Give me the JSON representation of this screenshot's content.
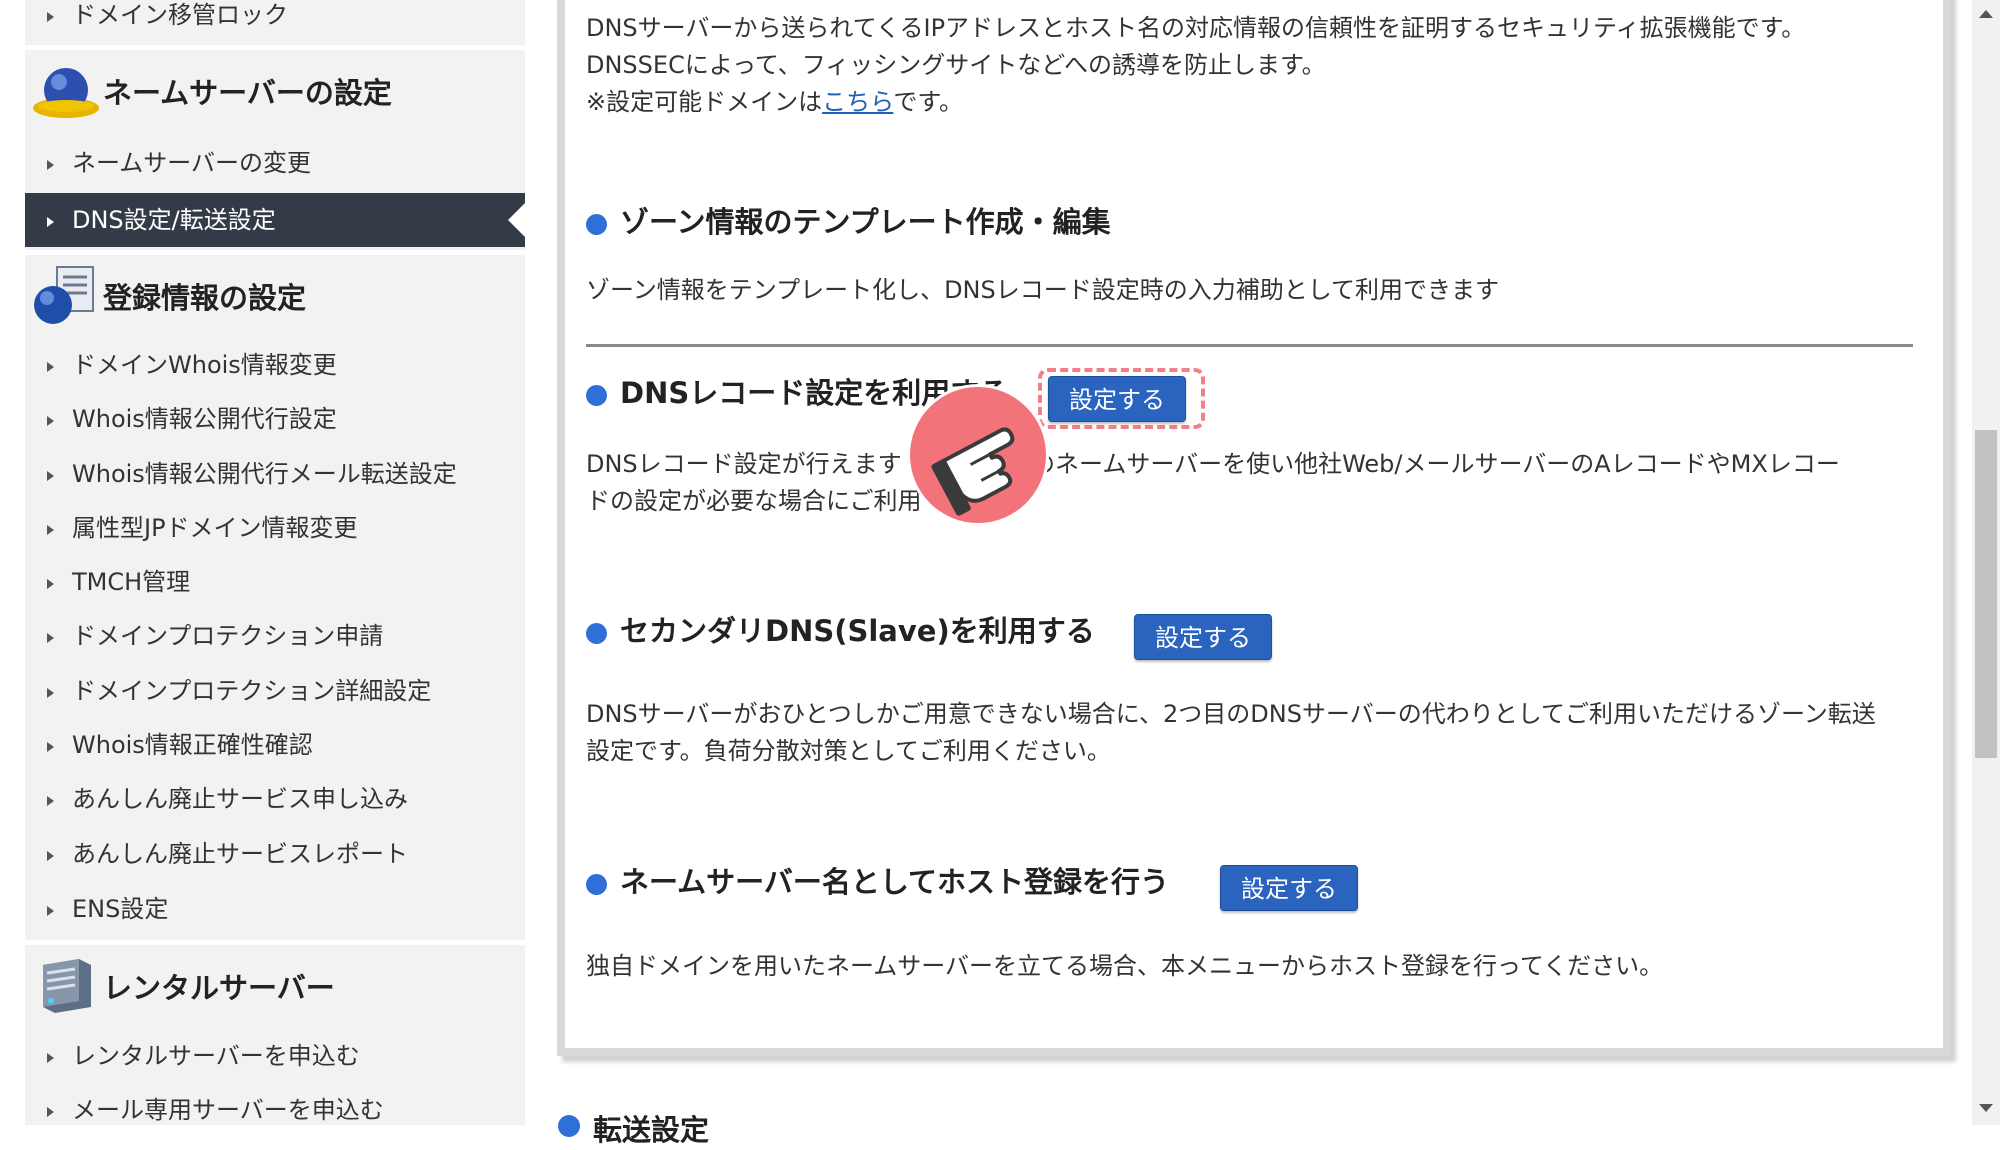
{
  "sidebar": {
    "top_item": "ドメイン移管ロック",
    "nameserver": {
      "heading": "ネームサーバーの設定",
      "items": [
        "ネームサーバーの変更",
        "DNS設定/転送設定"
      ],
      "active_index": 1
    },
    "registration": {
      "heading": "登録情報の設定",
      "items": [
        "ドメインWhois情報変更",
        "Whois情報公開代行設定",
        "Whois情報公開代行メール転送設定",
        "属性型JPドメイン情報変更",
        "TMCH管理",
        "ドメインプロテクション申請",
        "ドメインプロテクション詳細設定",
        "Whois情報正確性確認",
        "あんしん廃止サービス申し込み",
        "あんしん廃止サービスレポート",
        "ENS設定"
      ]
    },
    "rental": {
      "heading": "レンタルサーバー",
      "items": [
        "レンタルサーバーを申込む",
        "メール専用サーバーを申込む"
      ]
    }
  },
  "main": {
    "dnssec": {
      "desc_line1": "DNSサーバーから送られてくるIPアドレスとホスト名の対応情報の信頼性を証明するセキュリティ拡張機能です。",
      "desc_line2": "DNSSECによって、フィッシングサイトなどへの誘導を防止します。",
      "note_prefix": "※設定可能ドメインは",
      "note_link": "こちら",
      "note_suffix": "です。"
    },
    "zone_template": {
      "title": "ゾーン情報のテンプレート作成・編集",
      "desc": "ゾーン情報をテンプレート化し、DNSレコード設定時の入力補助として利用できます"
    },
    "dns_record": {
      "title": "DNSレコード設定を利用する",
      "button": "設定する",
      "desc_line1_a": "DNSレコード設定が行えます",
      "desc_line1_b": "mのネームサーバーを使い他社Web/メールサーバーのAレコードやMXレコー",
      "desc_line2_a": "ドの設定が必要な場合にご利用",
      "desc_line2_b": "。"
    },
    "secondary_dns": {
      "title": "セカンダリDNS(Slave)を利用する",
      "button": "設定する",
      "desc_line1": "DNSサーバーがおひとつしかご用意できない場合に、2つ目のDNSサーバーの代わりとしてご利用いただけるゾーン転送",
      "desc_line2": "設定です。負荷分散対策としてご利用ください。"
    },
    "host_registration": {
      "title": "ネームサーバー名としてホスト登録を行う",
      "button": "設定する",
      "desc": "独自ドメインを用いたネームサーバーを立てる場合、本メニューからホスト登録を行ってください。"
    },
    "next_section_partial": "転送設定"
  },
  "colors": {
    "sidebar_bg": "#f2f2f2",
    "sidebar_active_bg": "#333b46",
    "accent_blue": "#2f6fd8",
    "button_bg": "#2a64bf",
    "highlight_pink": "#f07f86"
  }
}
